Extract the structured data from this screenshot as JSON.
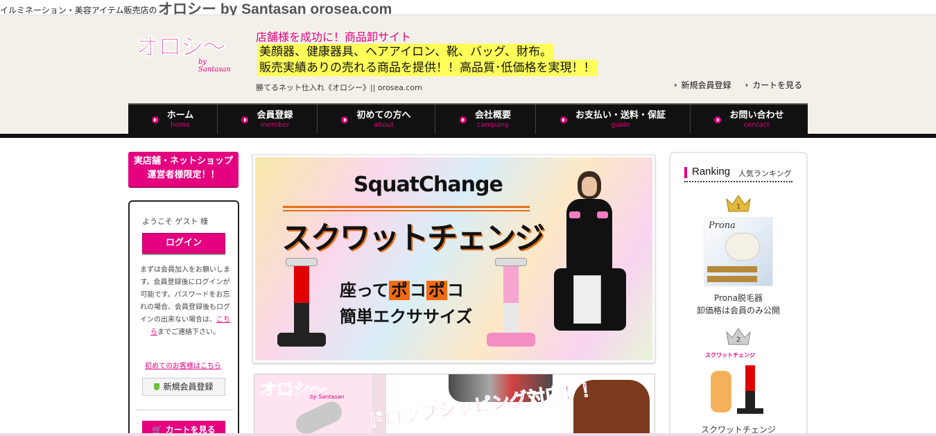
{
  "topbar": {
    "small_text": "イルミネーション・美容アイテム販売店の",
    "big_text": "オロシー by Santasan orosea.com"
  },
  "header": {
    "logo_main": "オロシ〜",
    "logo_sub": "by Santasan",
    "tagline1": "店舗様を成功に！商品卸サイト",
    "tagline2": "美顔器、健康器具、ヘアアイロン、靴、バッグ、財布。",
    "tagline3": "販売実績ありの売れる商品を提供！！高品質･低価格を実現！！",
    "subtitle": "勝てるネット仕入れ《オロシー》|| orosea.com",
    "links": {
      "register": "新規会員登録",
      "cart": "カートを見る"
    }
  },
  "nav": [
    {
      "jp": "ホーム",
      "en": "home"
    },
    {
      "jp": "会員登録",
      "en": "member"
    },
    {
      "jp": "初めての方へ",
      "en": "about"
    },
    {
      "jp": "会社概要",
      "en": "campany"
    },
    {
      "jp": "お支払い・送料・保証",
      "en": "guide"
    },
    {
      "jp": "お問い合わせ",
      "en": "contact"
    }
  ],
  "sidebar": {
    "promo_line1": "実店舗・ネットショップ",
    "promo_line2": "運営者様限定！！",
    "welcome": "ようこそ ゲスト 様",
    "login_button": "ログイン",
    "note": "まずは会員加入をお願いします。会員登録後にログインが可能です。パスワードをお忘れの場合、会員登録後もログインの出来ない場合は、",
    "note_link": "こちら",
    "note_tail": "までご連絡下さい。",
    "first_time_link": "初めてのお客様はこちら",
    "register_button": "新規会員登録",
    "cart_button": "カートを見る"
  },
  "banner1": {
    "en_title": "SquatChange",
    "jp_title": "スクワットチェンジ",
    "sit_pre": "座って",
    "poko1": "ポ",
    "ko1": "コ",
    "poko2": "ポ",
    "ko2": "コ",
    "easy": "簡単エクササイズ"
  },
  "banner2": {
    "logo": "オロシ〜",
    "logo_sub": "by Santasan",
    "headline": "ドロップシッピング対応！！"
  },
  "ranking": {
    "title_en": "Ranking",
    "title_jp": "人気ランキング",
    "items": [
      {
        "rank": "1",
        "image_label": "Prona",
        "name_line1": "Prona脱毛器",
        "name_line2": "卸価格は会員のみ公開"
      },
      {
        "rank": "2",
        "image_label": "スクワットチェンジ",
        "name_line1": "スクワットチェンジ",
        "name_line2": ""
      }
    ]
  },
  "colors": {
    "brand_pink": "#e4007f",
    "nav_bg": "#111111",
    "header_bg": "#f3f0ea",
    "highlight_yellow": "#ffff5a"
  }
}
